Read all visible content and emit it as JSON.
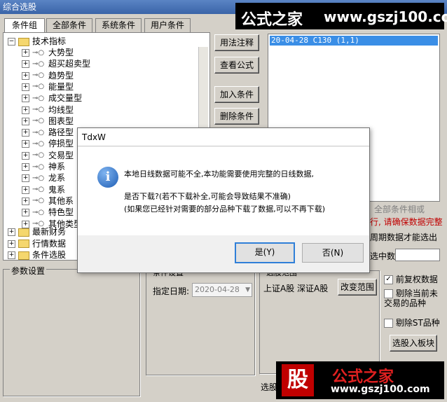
{
  "window": {
    "title": "综合选股"
  },
  "tabs": [
    "条件组",
    "全部条件",
    "系统条件",
    "用户条件"
  ],
  "tree": {
    "root": "技术指标",
    "children": [
      "大势型",
      "超买超卖型",
      "趋势型",
      "能量型",
      "成交量型",
      "均线型",
      "图表型",
      "路径型",
      "停损型",
      "交易型",
      "神系",
      "龙系",
      "鬼系",
      "其他系",
      "特色型",
      "其他类型"
    ],
    "folders": [
      "最新财务",
      "行情数据",
      "条件选股"
    ]
  },
  "buttons": {
    "usage": "用法注释",
    "formula": "查看公式",
    "add": "加入条件",
    "delete": "删除条件",
    "change_range": "改变范围",
    "add_block": "选股入板块"
  },
  "condition_list": {
    "selected": "20-04-28 C130 (1,1)"
  },
  "right_panel": {
    "all_conditions": "全部条件相或",
    "warn1": "行, 请确保数据完整",
    "warn2": "周期数据才能选出",
    "pick_label": "选中数"
  },
  "params": {
    "title": "参数设置"
  },
  "time_group": {
    "title": "条件设置",
    "date_label": "指定日期:",
    "date_value": "2020-04-28"
  },
  "range_group": {
    "title": "选股范围",
    "text": "上证A股 深证A股"
  },
  "options": {
    "adjust": "前复权数据",
    "exclude_suspended": "剔除当前未交易的品种",
    "exclude_st": "剔除ST品种"
  },
  "bottom": {
    "label": "选股"
  },
  "dialog": {
    "title": "TdxW",
    "line1": "本地日线数据可能不全,本功能需要使用完整的日线数据,",
    "line2": "是否下载?(若不下载补全,可能会导致结果不准确)",
    "line3": "(如果您已经针对需要的部分品种下载了数据,可以不再下载)",
    "yes": "是(Y)",
    "no": "否(N)",
    "info_icon": "i"
  },
  "watermark": {
    "top_cn": "公式之家",
    "top_url": "www.gszj100.com",
    "bot_badge": "股",
    "bot_cn": "公式之家",
    "bot_url": "www.gszj100.com"
  },
  "colors": {
    "title_bar": "#3a64a8",
    "selection": "#3a8ee6",
    "warning": "#c00000",
    "dialog_default": "#2f7fd8"
  }
}
